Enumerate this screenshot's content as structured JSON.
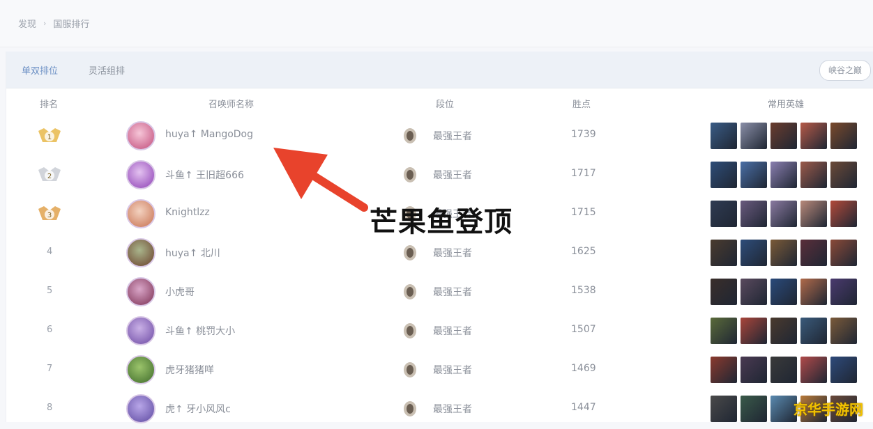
{
  "breadcrumb": {
    "home": "发现",
    "separator": "›",
    "current": "国服排行"
  },
  "tabs": {
    "active": "单双排位",
    "second": "灵活组排",
    "right_pill": "峡谷之巅"
  },
  "table_headers": {
    "rank": "排名",
    "name": "召唤师名称",
    "tier": "段位",
    "points": "胜点",
    "heroes": "常用英雄"
  },
  "rows": [
    {
      "rank": "1",
      "name": "huya↑ MangoDog",
      "tier": "最强王者",
      "points": "1739"
    },
    {
      "rank": "2",
      "name": "斗鱼↑ 王旧超666",
      "tier": "最强王者",
      "points": "1717"
    },
    {
      "rank": "3",
      "name": "Knightlzz",
      "tier": "最强王者",
      "points": "1715"
    },
    {
      "rank": "4",
      "name": "huya↑ 北川",
      "tier": "最强王者",
      "points": "1625"
    },
    {
      "rank": "5",
      "name": "小虎哥",
      "tier": "最强王者",
      "points": "1538"
    },
    {
      "rank": "6",
      "name": "斗鱼↑ 桃罚大小",
      "tier": "最强王者",
      "points": "1507"
    },
    {
      "rank": "7",
      "name": "虎牙猪猪咩",
      "tier": "最强王者",
      "points": "1469"
    },
    {
      "rank": "8",
      "name": "虎↑ 牙小风风c",
      "tier": "最强王者",
      "points": "1447"
    }
  ],
  "overlay_caption": "芒果鱼登顶",
  "watermark": "京华手游网",
  "colors": {
    "accent_tab": "#6b8fc4",
    "arrow": "#e8432c",
    "gold": "#e7b84a",
    "silver": "#c9ccd3",
    "bronze": "#e0a24e",
    "watermark": "#f2c200"
  }
}
